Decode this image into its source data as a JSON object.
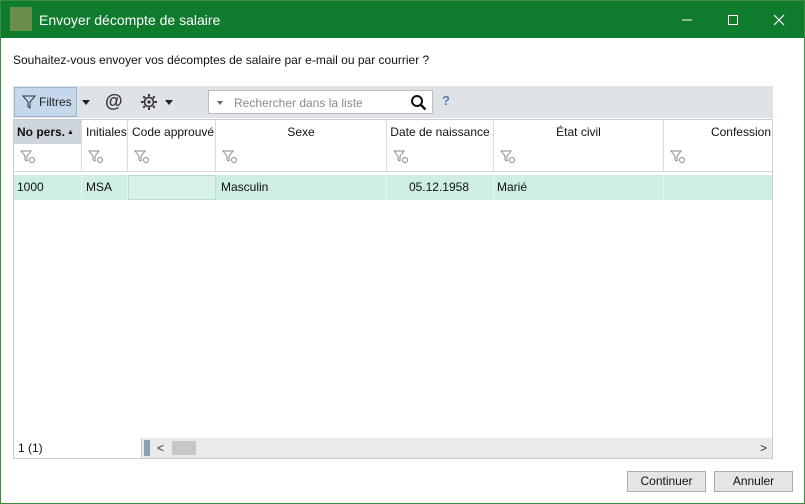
{
  "window": {
    "title": "Envoyer décompte de salaire"
  },
  "prompt": "Souhaitez-vous envoyer vos décomptes de salaire par e-mail ou par courrier ?",
  "toolbar": {
    "filter_label": "Filtres",
    "at_symbol": "@",
    "search_placeholder": "Rechercher dans la liste",
    "help_symbol": "?"
  },
  "table": {
    "columns": [
      "No pers.",
      "Initiales",
      "Code approuvé",
      "Sexe",
      "Date de naissance",
      "État civil",
      "Confession"
    ],
    "sorted_column": "No pers.",
    "sort_arrow": "▲",
    "rows": [
      [
        "1000",
        "MSA",
        "",
        "Masculin",
        "05.12.1958",
        "Marié",
        ""
      ]
    ],
    "selected_row_color": "#cdeee1"
  },
  "status": {
    "count": "1 (1)",
    "scroll_left": "<",
    "scroll_right": ">"
  },
  "buttons": {
    "continue": "Continuer",
    "cancel": "Annuler"
  },
  "colors": {
    "titlebar": "#0f7b2c",
    "toolbar": "#dfe3e8",
    "filter_button": "#c5d7ea"
  }
}
